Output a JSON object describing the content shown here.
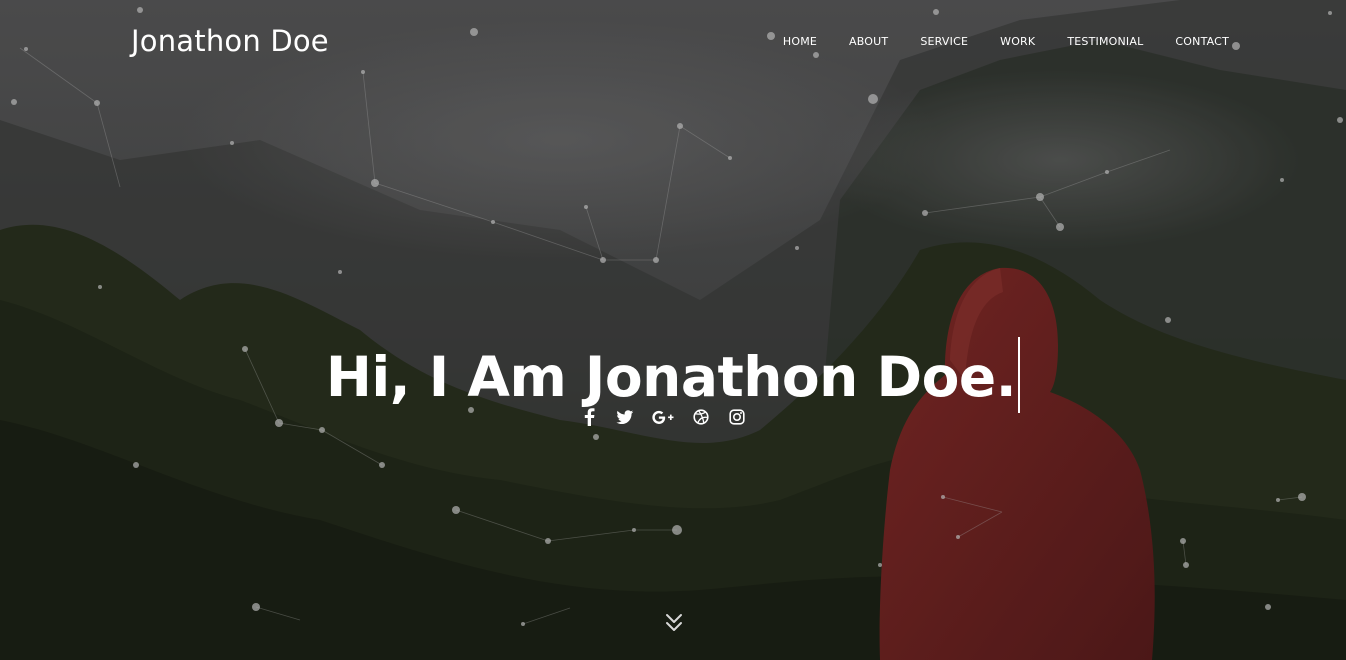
{
  "brand": {
    "name": "Jonathon Doe"
  },
  "nav": {
    "items": [
      {
        "label": "HOME"
      },
      {
        "label": "ABOUT"
      },
      {
        "label": "SERVICE"
      },
      {
        "label": "WORK"
      },
      {
        "label": "TESTIMONIAL"
      },
      {
        "label": "CONTACT"
      }
    ]
  },
  "hero": {
    "headline": "Hi, I Am Jonathon Doe.",
    "socials": [
      "facebook-icon",
      "twitter-icon",
      "google-plus-icon",
      "dribbble-icon",
      "instagram-icon"
    ],
    "scroll_icon": "chevron-double-down-icon"
  },
  "colors": {
    "text": "#ffffff",
    "hoodie": "#7a2a2a",
    "forest": "#2f3a22",
    "fog": "#5a5a5a"
  }
}
